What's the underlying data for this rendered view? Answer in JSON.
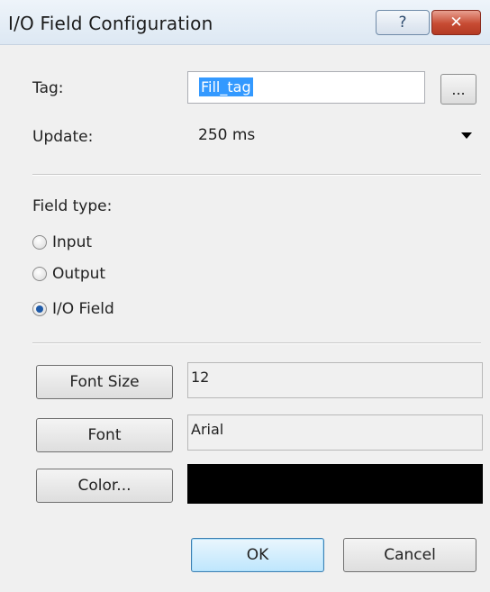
{
  "window": {
    "title": "I/O Field Configuration",
    "help_label": "?",
    "close_label": "✕"
  },
  "tag": {
    "label": "Tag:",
    "value": "Fill_tag",
    "browse_label": "..."
  },
  "update": {
    "label": "Update:",
    "value": "250 ms"
  },
  "field_type": {
    "label": "Field type:",
    "options": [
      {
        "label": "Input",
        "checked": false
      },
      {
        "label": "Output",
        "checked": false
      },
      {
        "label": "I/O Field",
        "checked": true
      }
    ]
  },
  "properties": {
    "font_size_button": "Font Size",
    "font_size_value": "12",
    "font_button": "Font",
    "font_value": "Arial",
    "color_button": "Color...",
    "color_value": "#000000"
  },
  "buttons": {
    "ok": "OK",
    "cancel": "Cancel"
  }
}
